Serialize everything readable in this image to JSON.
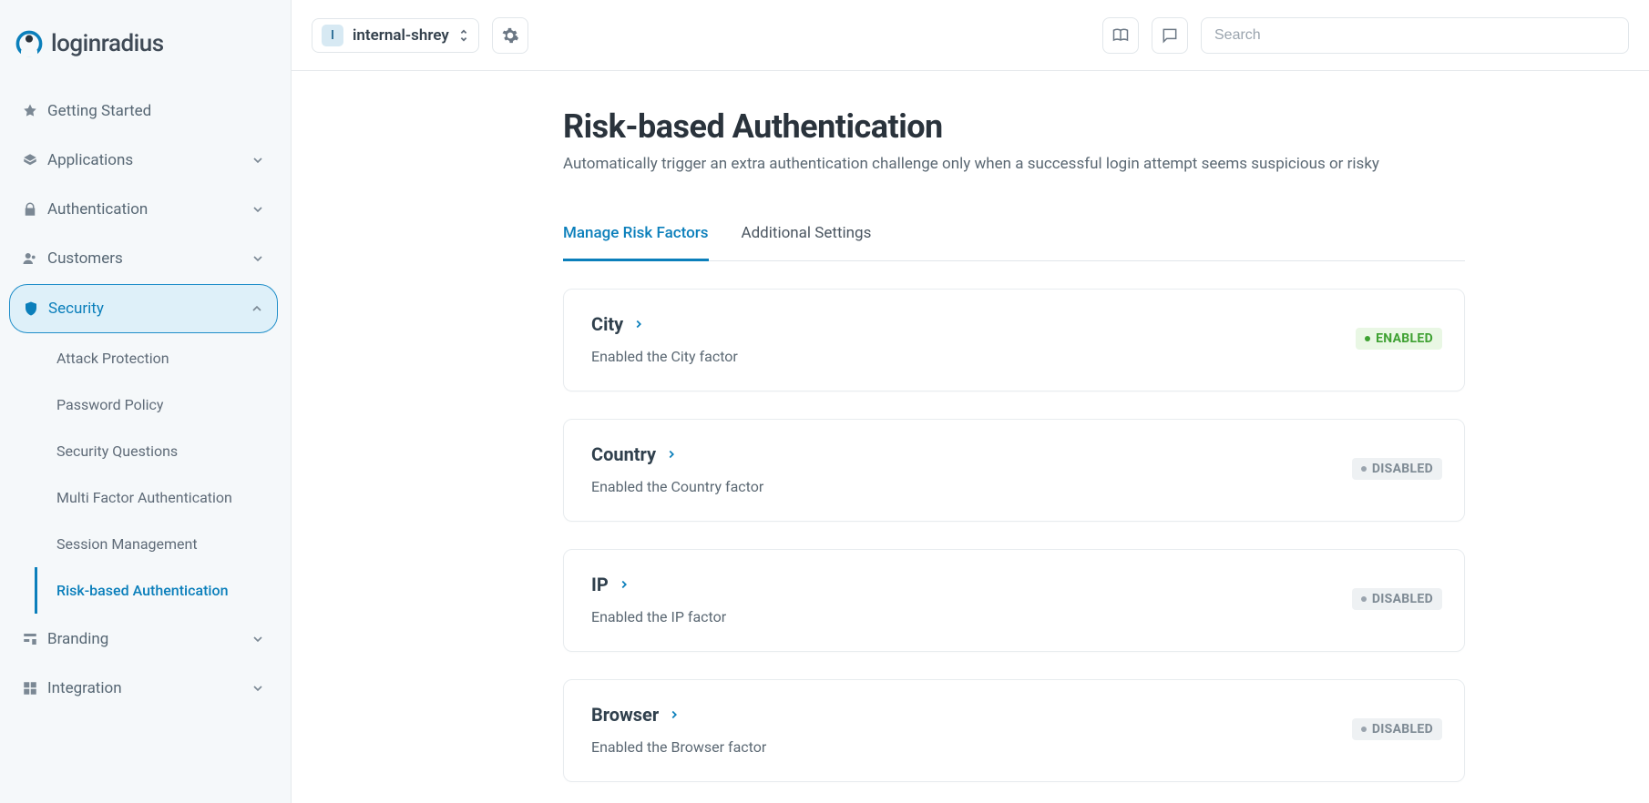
{
  "brand": "loginradius",
  "header": {
    "project_badge": "I",
    "project_name": "internal-shrey",
    "search_placeholder": "Search"
  },
  "sidebar": {
    "items": [
      {
        "label": "Getting Started"
      },
      {
        "label": "Applications"
      },
      {
        "label": "Authentication"
      },
      {
        "label": "Customers"
      },
      {
        "label": "Security"
      },
      {
        "label": "Branding"
      },
      {
        "label": "Integration"
      }
    ],
    "security_sub": [
      {
        "label": "Attack Protection"
      },
      {
        "label": "Password Policy"
      },
      {
        "label": "Security Questions"
      },
      {
        "label": "Multi Factor Authentication"
      },
      {
        "label": "Session Management"
      },
      {
        "label": "Risk-based Authentication"
      }
    ]
  },
  "page": {
    "title": "Risk-based Authentication",
    "subtitle": "Automatically trigger an extra authentication challenge only when a successful login attempt seems suspicious or risky"
  },
  "tabs": [
    {
      "label": "Manage Risk Factors"
    },
    {
      "label": "Additional Settings"
    }
  ],
  "factors": [
    {
      "title": "City",
      "desc": "Enabled the City factor",
      "status": "ENABLED"
    },
    {
      "title": "Country",
      "desc": "Enabled the Country factor",
      "status": "DISABLED"
    },
    {
      "title": "IP",
      "desc": "Enabled the IP factor",
      "status": "DISABLED"
    },
    {
      "title": "Browser",
      "desc": "Enabled the Browser factor",
      "status": "DISABLED"
    }
  ]
}
